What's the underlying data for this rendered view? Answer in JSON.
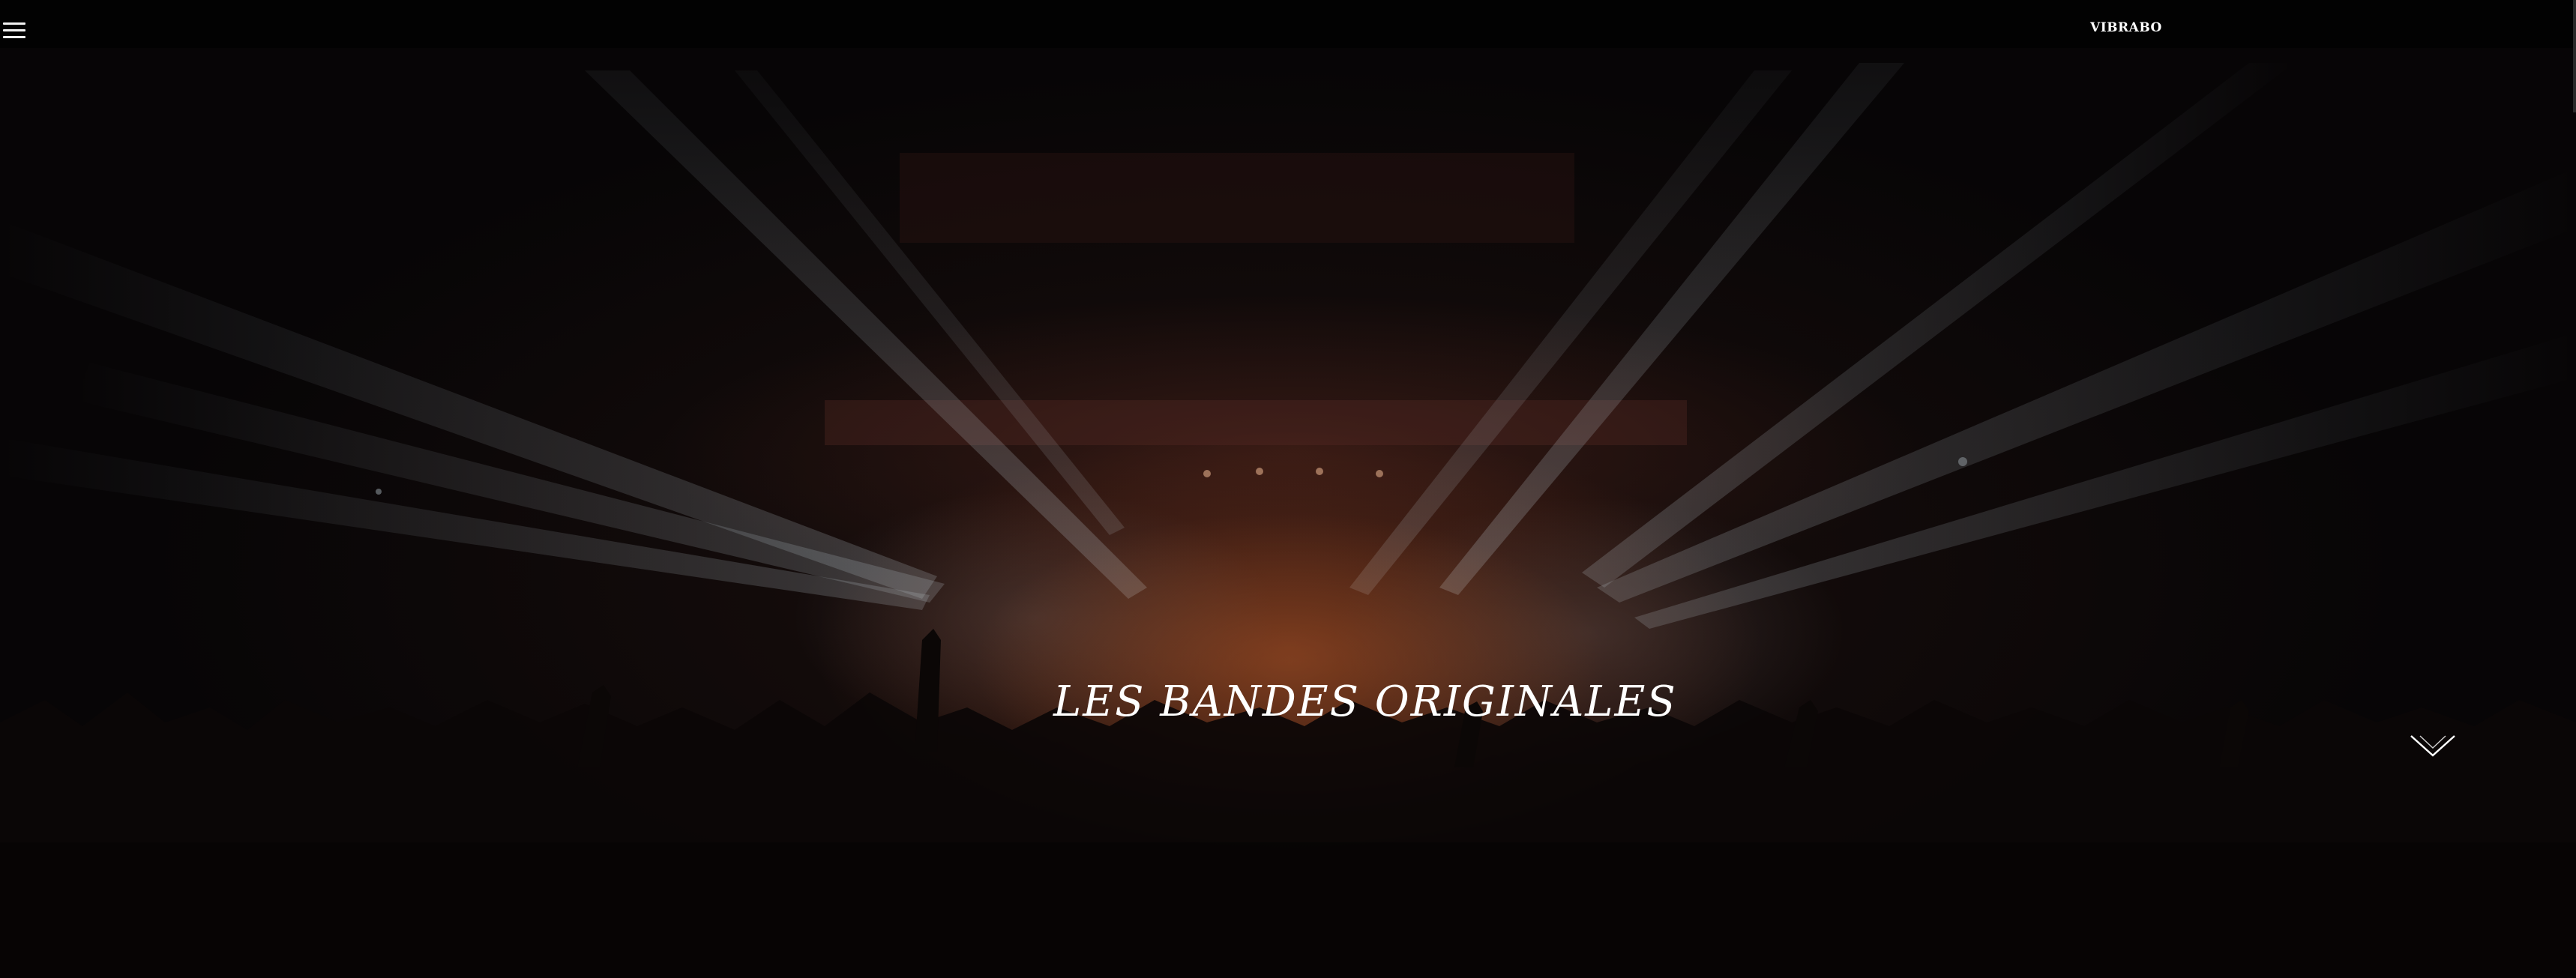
{
  "header": {
    "brand": "VIBRABO",
    "menu_icon": "hamburger-menu-icon"
  },
  "hero": {
    "title": "LES BANDES ORIGINALES",
    "background": "concert-crowd-stage-lights-photo",
    "scroll_icon": "chevron-down-icon"
  },
  "colors": {
    "topbar": "#020202",
    "text": "#ffffff",
    "light_beam": "#c8d8e0",
    "stage_glow": "#8c3c1e"
  }
}
